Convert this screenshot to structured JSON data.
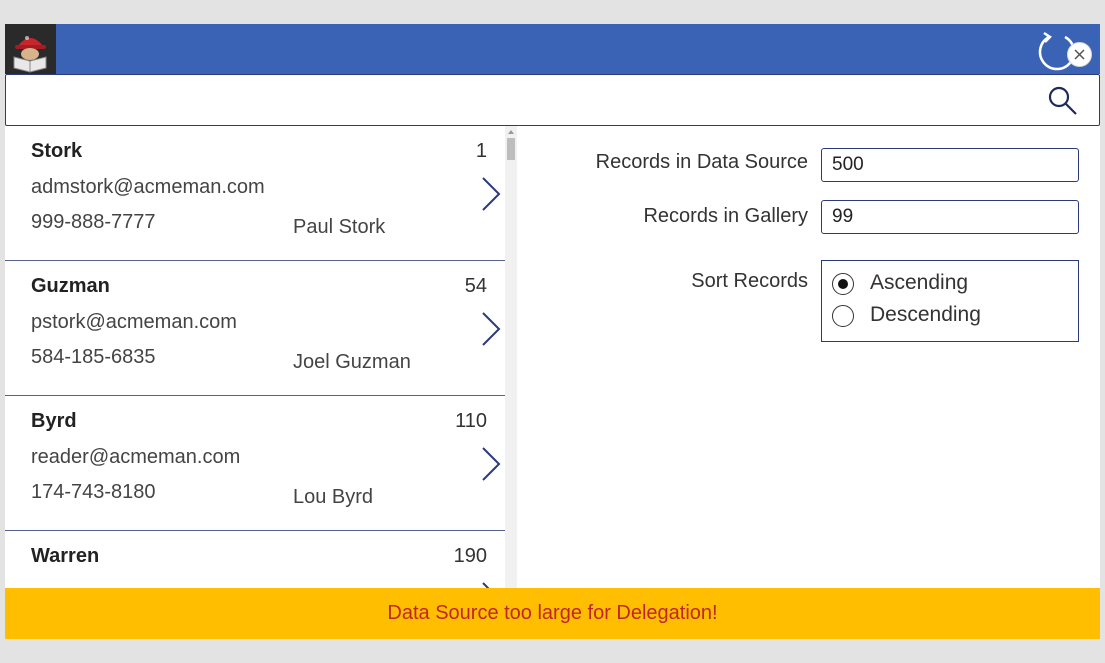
{
  "header": {
    "accent_color": "#3a63b6",
    "logo_icon": "hard-hat-reader-icon",
    "refresh_icon": "refresh-icon",
    "close_icon": "close-icon"
  },
  "search": {
    "value": "",
    "placeholder": "",
    "icon": "search-icon"
  },
  "gallery": {
    "items": [
      {
        "last_name": "Stork",
        "id": "1",
        "email": "admstork@acmeman.com",
        "phone": "999-888-7777",
        "full_name": "Paul Stork"
      },
      {
        "last_name": "Guzman",
        "id": "54",
        "email": "pstork@acmeman.com",
        "phone": "584-185-6835",
        "full_name": "Joel Guzman"
      },
      {
        "last_name": "Byrd",
        "id": "110",
        "email": "reader@acmeman.com",
        "phone": "174-743-8180",
        "full_name": "Lou Byrd"
      },
      {
        "last_name": "Warren",
        "id": "190",
        "email": "",
        "phone": "",
        "full_name": ""
      }
    ]
  },
  "stats": {
    "records_in_source_label": "Records in Data Source",
    "records_in_source_value": "500",
    "records_in_gallery_label": "Records in Gallery",
    "records_in_gallery_value": "99"
  },
  "sort": {
    "label": "Sort Records",
    "options": [
      "Ascending",
      "Descending"
    ],
    "selected": "Ascending"
  },
  "banner": {
    "text": "Data Source too large for Delegation!",
    "bg_color": "#ffbf00",
    "text_color": "#c0252b"
  }
}
